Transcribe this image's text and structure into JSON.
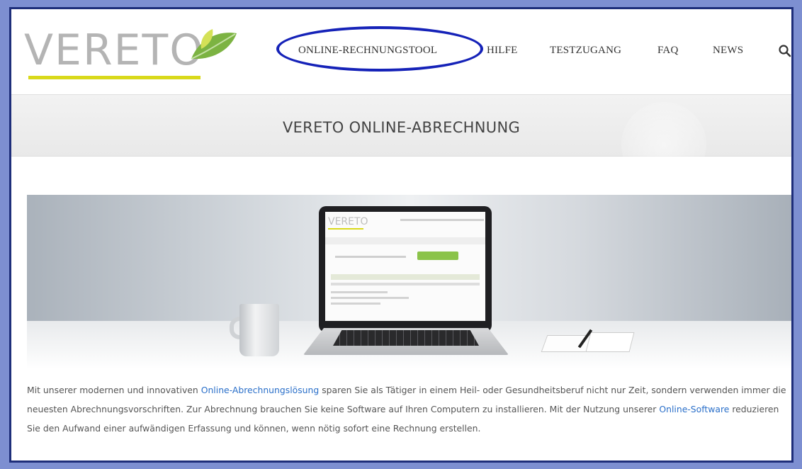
{
  "logo": {
    "text": "VERETO"
  },
  "nav": {
    "items": [
      "ONLINE-RECHNUNGSTOOL",
      "HILFE",
      "TESTZUGANG",
      "FAQ",
      "NEWS"
    ],
    "search_icon": "search-icon"
  },
  "title_band": {
    "title": "VERETO ONLINE-ABRECHNUNG"
  },
  "hero": {
    "screen_logo": "VERETO"
  },
  "paragraph": {
    "t1": "Mit unserer modernen und innovativen ",
    "link1": "Online-Abrechnungslösung",
    "t2": " sparen Sie als Tätiger in einem Heil- oder Gesundheitsberuf nicht nur Zeit, sondern verwenden immer die neuesten Abrechnungsvorschriften. Zur Abrechnung brauchen Sie keine Software auf Ihren Computern zu installieren. Mit der Nutzung unserer ",
    "link2": "Online-Software",
    "t3": " reduzieren Sie den Aufwand einer aufwändigen Erfassung und können, wenn nötig sofort eine Rechnung erstellen."
  },
  "colors": {
    "outer_background": "#7d8fd1",
    "frame_border": "#1e2e7a",
    "annotation_ellipse": "#1522b8",
    "logo_gray": "#b4b4b4",
    "logo_yellow": "#d9d91a",
    "leaf_green": "#8bc34a",
    "link_blue": "#2a6fc9"
  }
}
